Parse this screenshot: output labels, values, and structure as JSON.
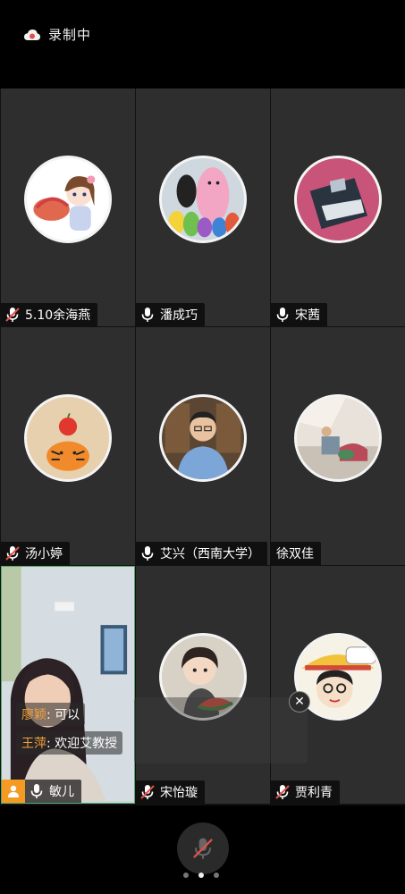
{
  "status": {
    "recording_label": "录制中"
  },
  "participants": [
    {
      "name": "5.10余海燕",
      "mic": "muted"
    },
    {
      "name": "潘成巧",
      "mic": "on"
    },
    {
      "name": "宋茜",
      "mic": "on"
    },
    {
      "name": "汤小婷",
      "mic": "muted"
    },
    {
      "name": "艾兴（西南大学）",
      "mic": "on"
    },
    {
      "name": "徐双佳",
      "mic": "none"
    },
    {
      "name": "敏儿",
      "mic": "on"
    },
    {
      "name": "宋怡璇",
      "mic": "muted"
    },
    {
      "name": "贾利青",
      "mic": "muted"
    }
  ],
  "chat": [
    {
      "sender": "廖颖",
      "text": "可以"
    },
    {
      "sender": "王萍",
      "text": "欢迎艾教授"
    }
  ],
  "chat_close_symbol": "✕",
  "pager": {
    "pages": 3,
    "active": 2
  },
  "colors": {
    "tile_bg": "#2e2e2e",
    "active_speaker_border": "#5aa96b",
    "host_badge": "#f59a23",
    "muted_mic": "#e0504a"
  }
}
